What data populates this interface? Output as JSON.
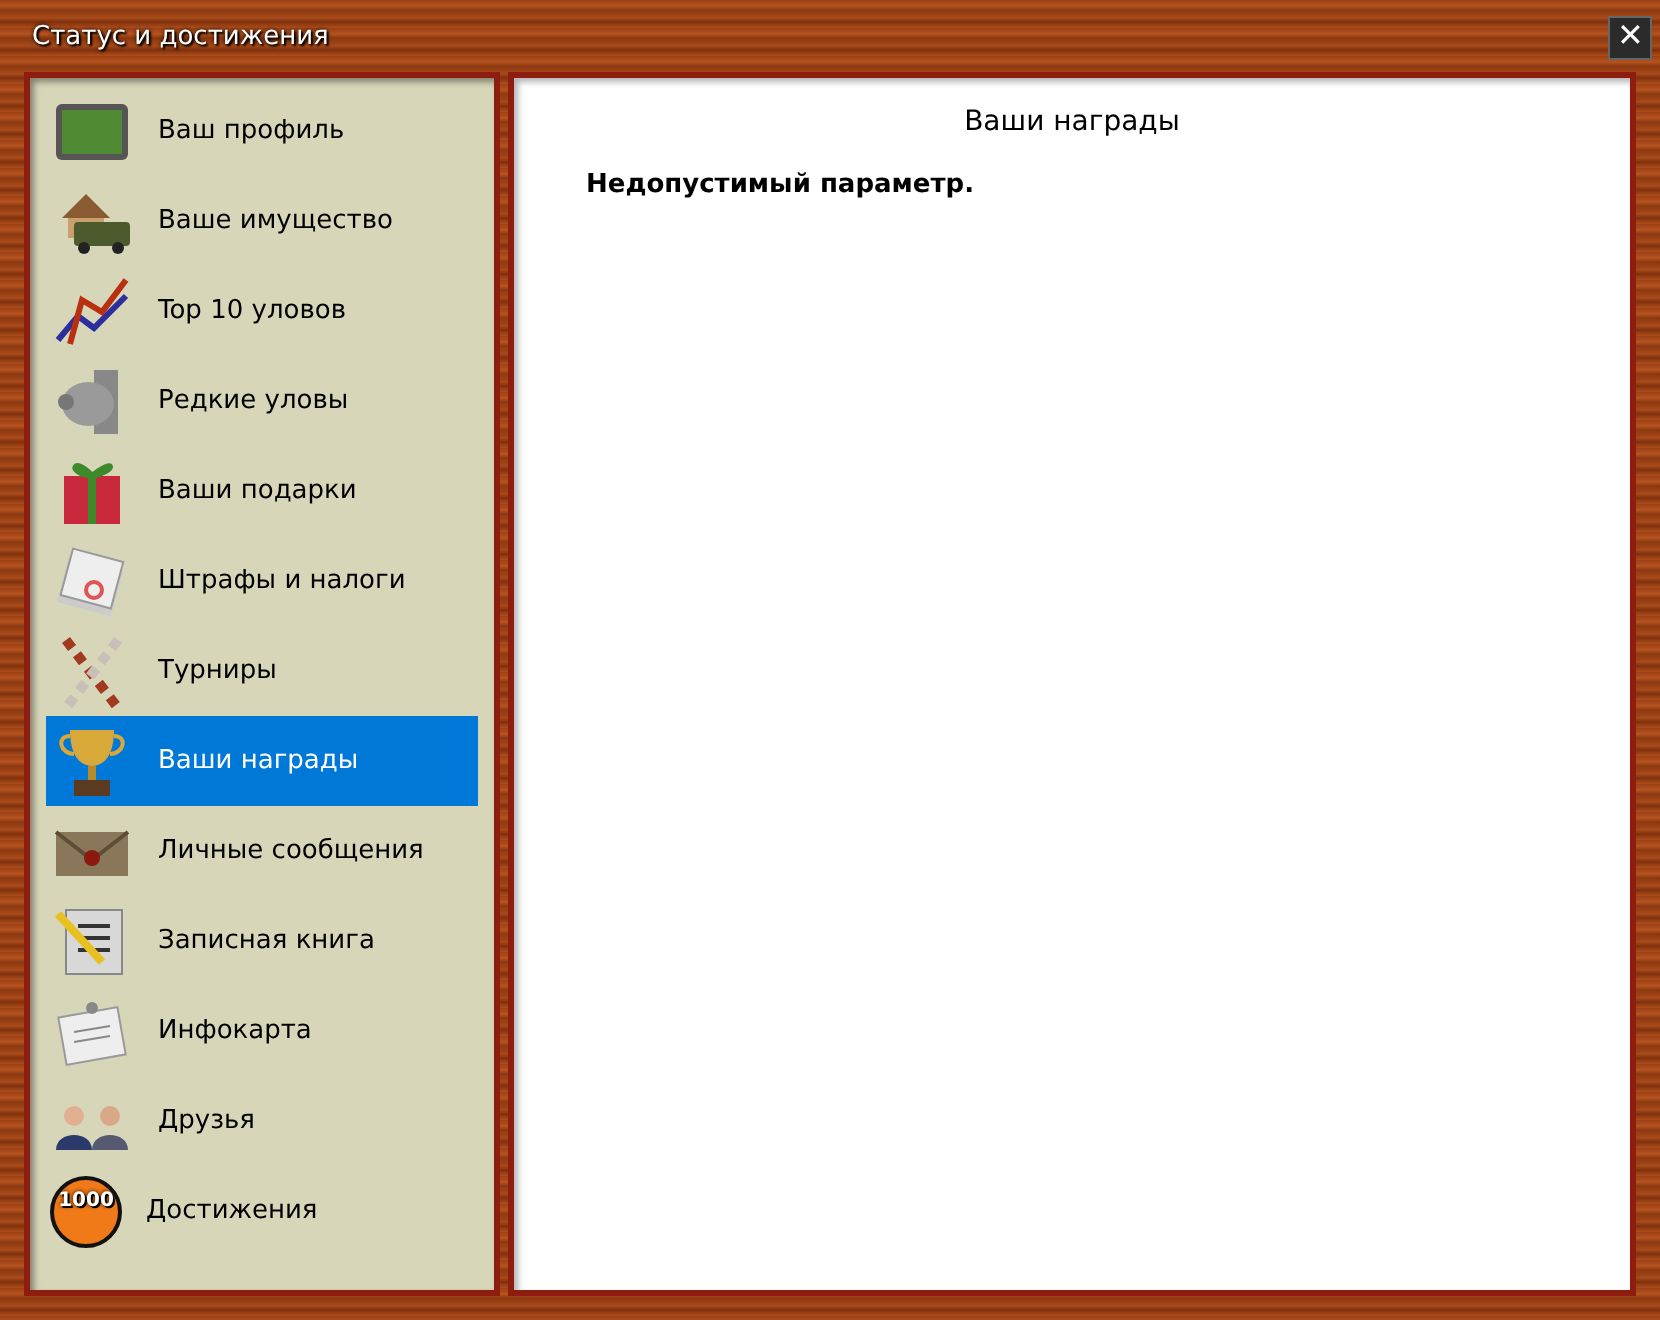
{
  "window": {
    "title": "Статус и достижения",
    "close": "✕"
  },
  "sidebar": {
    "items": [
      {
        "kind": "profile",
        "label": "Ваш профиль",
        "selected": false
      },
      {
        "kind": "property",
        "label": "Ваше имущество",
        "selected": false
      },
      {
        "kind": "chart",
        "label": "Top 10 уловов",
        "selected": false
      },
      {
        "kind": "rare",
        "label": "Редкие уловы",
        "selected": false
      },
      {
        "kind": "gift",
        "label": "Ваши подарки",
        "selected": false
      },
      {
        "kind": "fines",
        "label": "Штрафы и налоги",
        "selected": false
      },
      {
        "kind": "tournament",
        "label": "Турниры",
        "selected": false
      },
      {
        "kind": "trophy",
        "label": "Ваши награды",
        "selected": true
      },
      {
        "kind": "envelope",
        "label": "Личные сообщения",
        "selected": false
      },
      {
        "kind": "notebook",
        "label": "Записная книга",
        "selected": false
      },
      {
        "kind": "card",
        "label": "Инфокарта",
        "selected": false
      },
      {
        "kind": "friends",
        "label": "Друзья",
        "selected": false
      },
      {
        "kind": "achievement",
        "label": "Достижения",
        "selected": false,
        "icon_text": "1000"
      }
    ]
  },
  "content": {
    "heading": "Ваши награды",
    "message": "Недопустимый параметр."
  }
}
